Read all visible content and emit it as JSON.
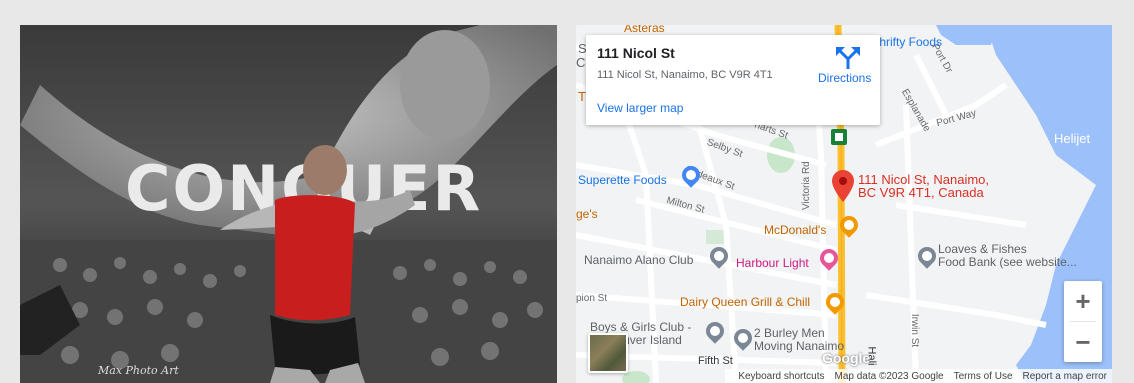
{
  "photo": {
    "banner_text": "CONQUER",
    "credit": "Max Photo Art"
  },
  "map": {
    "card": {
      "title": "111 Nicol St",
      "address": "111 Nicol St, Nanaimo, BC V9R 4T1",
      "directions": "Directions",
      "view_larger": "View larger map"
    },
    "marker_label_line1": "111 Nicol St, Nanaimo,",
    "marker_label_line2": "BC V9R 4T1, Canada",
    "pois": {
      "thrifty": "Thrifty Foods",
      "asteras": "Asteras",
      "superette": "Superette Foods",
      "mcdonalds": "McDonald's",
      "alano": "Nanaimo Alano Club",
      "harbour": "Harbour Light",
      "loaves1": "Loaves & Fishes",
      "loaves2": "Food Bank (see website...",
      "dairy": "Dairy Queen Grill & Chill",
      "boys1": "Boys & Girls Club -",
      "boys2": "Vancouver Island",
      "burley1": "2 Burley Men",
      "burley2": "Moving Nanaimo",
      "helijet": "Helijet",
      "ges": "ge's"
    },
    "roads": {
      "selby": "Selby St",
      "prideaux": "Prideaux St",
      "milton": "Milton St",
      "victoria": "Victoria Rd",
      "fifth": "Fifth St",
      "port_way": "Port Way",
      "port_dr": "Port Dr",
      "esplanade": "Esplanade",
      "irwin": "Irwin St",
      "hali": "Hali",
      "pion": "pion St",
      "charts": "harts St",
      "cl": "Cl",
      "s": "S",
      "t": "T"
    },
    "zoom_in": "+",
    "zoom_out": "−",
    "google": "Google",
    "footer": {
      "shortcuts": "Keyboard shortcuts",
      "mapdata": "Map data ©2023 Google",
      "terms": "Terms of Use",
      "report": "Report a map error"
    },
    "colors": {
      "water": "#9cc0f9",
      "land": "#f1f3f4",
      "highway": "#fbc02d",
      "accent": "#1a73e8",
      "marker": "#ea4335"
    }
  }
}
